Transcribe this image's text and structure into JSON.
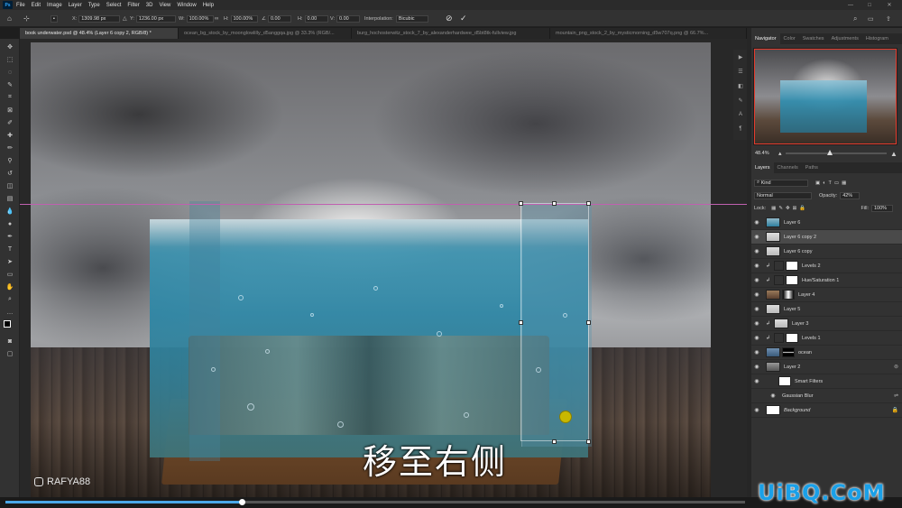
{
  "app": {
    "logo": "Ps"
  },
  "menu": [
    "File",
    "Edit",
    "Image",
    "Layer",
    "Type",
    "Select",
    "Filter",
    "3D",
    "View",
    "Window",
    "Help"
  ],
  "window_controls": [
    "—",
    "□",
    "✕"
  ],
  "options_bar": {
    "x_label": "X:",
    "x_value": "1309.98 px",
    "y_label": "Y:",
    "y_value": "1236.00 px",
    "w_label": "W:",
    "w_value": "100.00%",
    "h_label": "H:",
    "h_value": "100.00%",
    "angle_value": "0.00",
    "h_skew_label": "H:",
    "h_skew_value": "0.00",
    "v_skew_label": "V:",
    "v_skew_value": "0.00",
    "interpolation_label": "Interpolation:",
    "interpolation_value": "Bicubic"
  },
  "tabs": [
    "book underwater.psd @ 48.4% (Layer 6 copy 2, RGB/8) *",
    "ocean_bg_stock_by_moonglowlilly_d5anggqa.jpg @ 33.3% (RGB/...",
    "burg_hochosterwitz_stock_7_by_alexanderhardwee_d5bt8tk-fullview.jpg",
    "mountain_png_stock_2_by_mysticmorning_d5w707q.png @ 66.7%..."
  ],
  "canvas": {
    "subtitle": "移至右侧",
    "watermark": "RAFYA88"
  },
  "panels": {
    "top_tabs": [
      "Navigator",
      "Color",
      "Swatches",
      "Adjustments",
      "Histogram"
    ],
    "zoom": "48.4%",
    "layer_tabs": [
      "Layers",
      "Channels",
      "Paths"
    ],
    "kind_label": "Kind",
    "blend_mode": "Normal",
    "opacity_label": "Opacity:",
    "opacity_value": "42%",
    "lock_label": "Lock:",
    "fill_label": "Fill:",
    "fill_value": "100%"
  },
  "layers": [
    {
      "name": "Layer 6"
    },
    {
      "name": "Layer 6 copy 2"
    },
    {
      "name": "Layer 6 copy"
    },
    {
      "name": "Levels 2"
    },
    {
      "name": "Hue/Saturation 1"
    },
    {
      "name": "Layer 4"
    },
    {
      "name": "Layer 5"
    },
    {
      "name": "Layer 3"
    },
    {
      "name": "Levels 1"
    },
    {
      "name": "ocean"
    },
    {
      "name": "Layer 2"
    },
    {
      "name": "Smart Filters"
    },
    {
      "name": "Gaussian Blur"
    },
    {
      "name": "Background"
    }
  ],
  "video": {
    "progress": 0.32
  },
  "corner_watermark": "UiBQ.CoM"
}
